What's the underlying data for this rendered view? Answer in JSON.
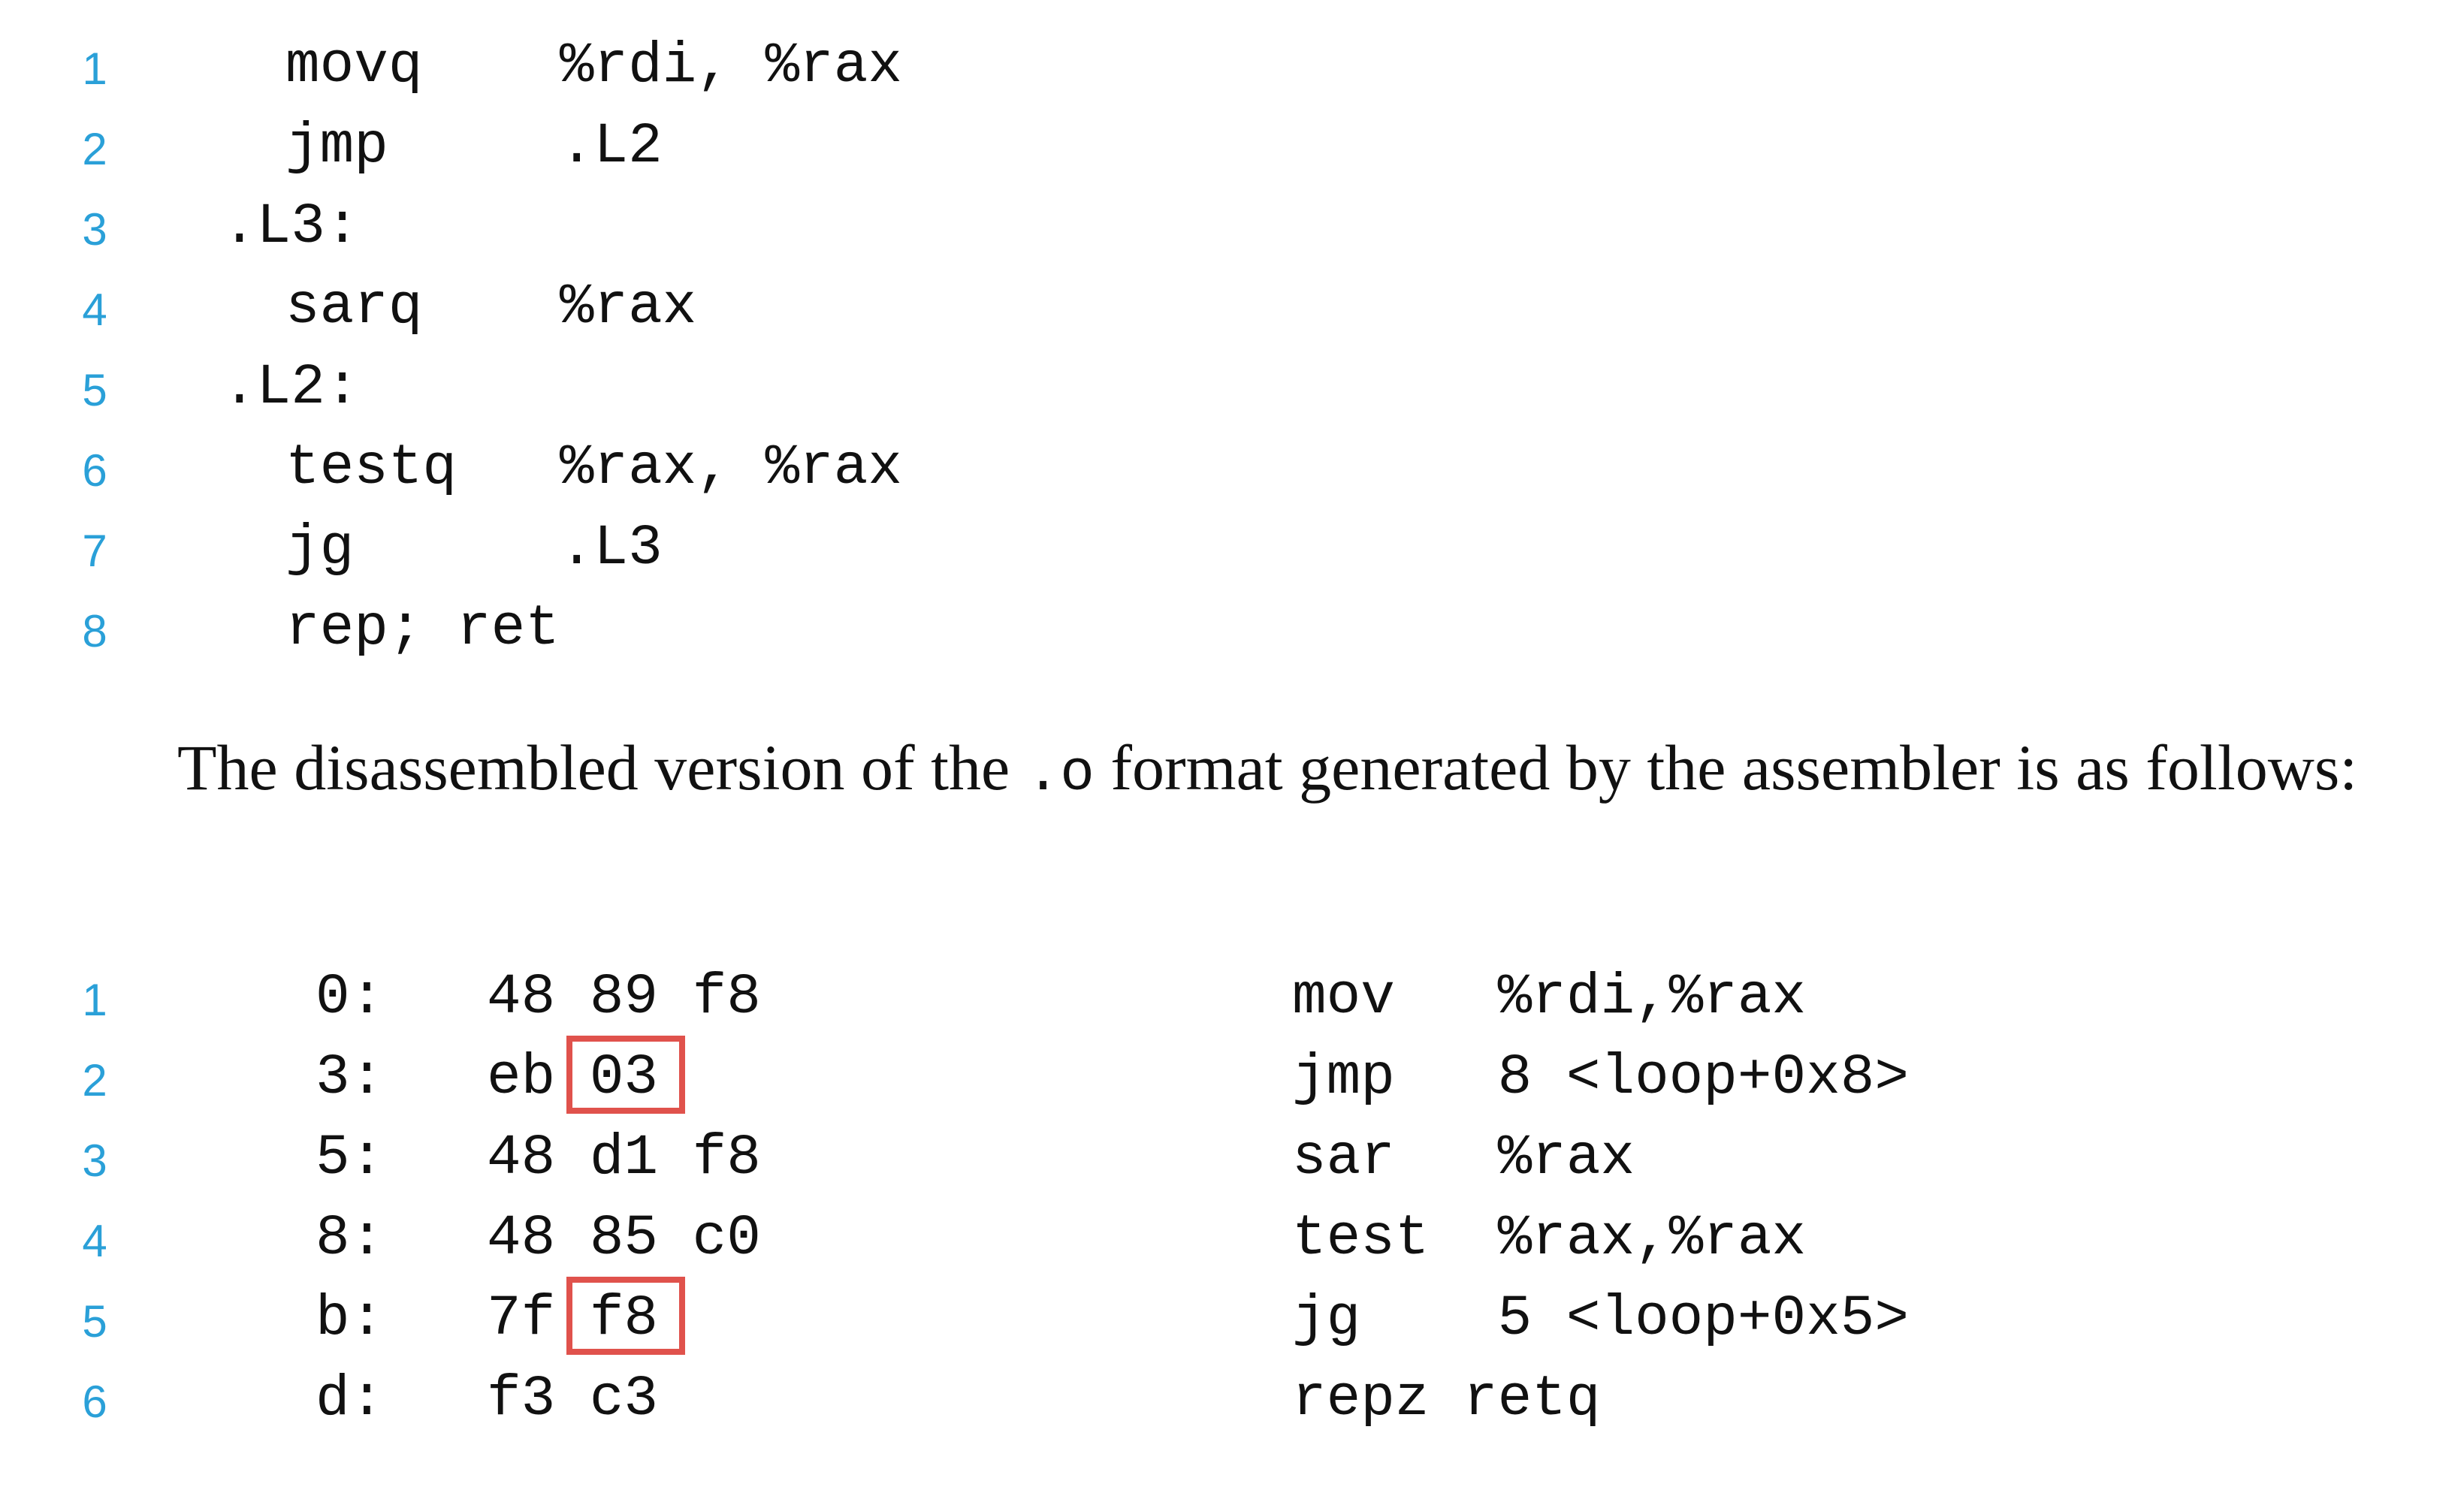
{
  "source_listing": [
    {
      "n": "1",
      "text": "movq    %rdi, %rax",
      "indent": 2
    },
    {
      "n": "2",
      "text": "jmp     .L2",
      "indent": 2
    },
    {
      "n": "3",
      "text": ".L3:",
      "indent": 1
    },
    {
      "n": "4",
      "text": "sarq    %rax",
      "indent": 2
    },
    {
      "n": "5",
      "text": ".L2:",
      "indent": 1
    },
    {
      "n": "6",
      "text": "testq   %rax, %rax",
      "indent": 2
    },
    {
      "n": "7",
      "text": "jg      .L3",
      "indent": 2
    },
    {
      "n": "8",
      "text": "rep; ret",
      "indent": 2
    }
  ],
  "paragraph": {
    "before": "The disassembled version of the ",
    "code": ".o",
    "after": " format generated by the assembler is as follows:"
  },
  "disassembly": [
    {
      "n": "1",
      "addr": "0:",
      "bytes": "48 89 f8",
      "asm": "mov   %rdi,%rax"
    },
    {
      "n": "2",
      "addr": "3:",
      "bytes": "eb 03",
      "asm": "jmp   8 <loop+0x8>"
    },
    {
      "n": "3",
      "addr": "5:",
      "bytes": "48 d1 f8",
      "asm": "sar   %rax"
    },
    {
      "n": "4",
      "addr": "8:",
      "bytes": "48 85 c0",
      "asm": "test  %rax,%rax"
    },
    {
      "n": "5",
      "addr": "b:",
      "bytes": "7f f8",
      "asm": "jg    5 <loop+0x5>"
    },
    {
      "n": "6",
      "addr": "d:",
      "bytes": "f3 c3",
      "asm": "repz retq"
    }
  ],
  "highlights": [
    {
      "row": "2",
      "byte": "03"
    },
    {
      "row": "5",
      "byte": "f8"
    }
  ],
  "colors": {
    "line_number": "#2aa0d8",
    "highlight_border": "#e0524c",
    "text": "#111111"
  }
}
